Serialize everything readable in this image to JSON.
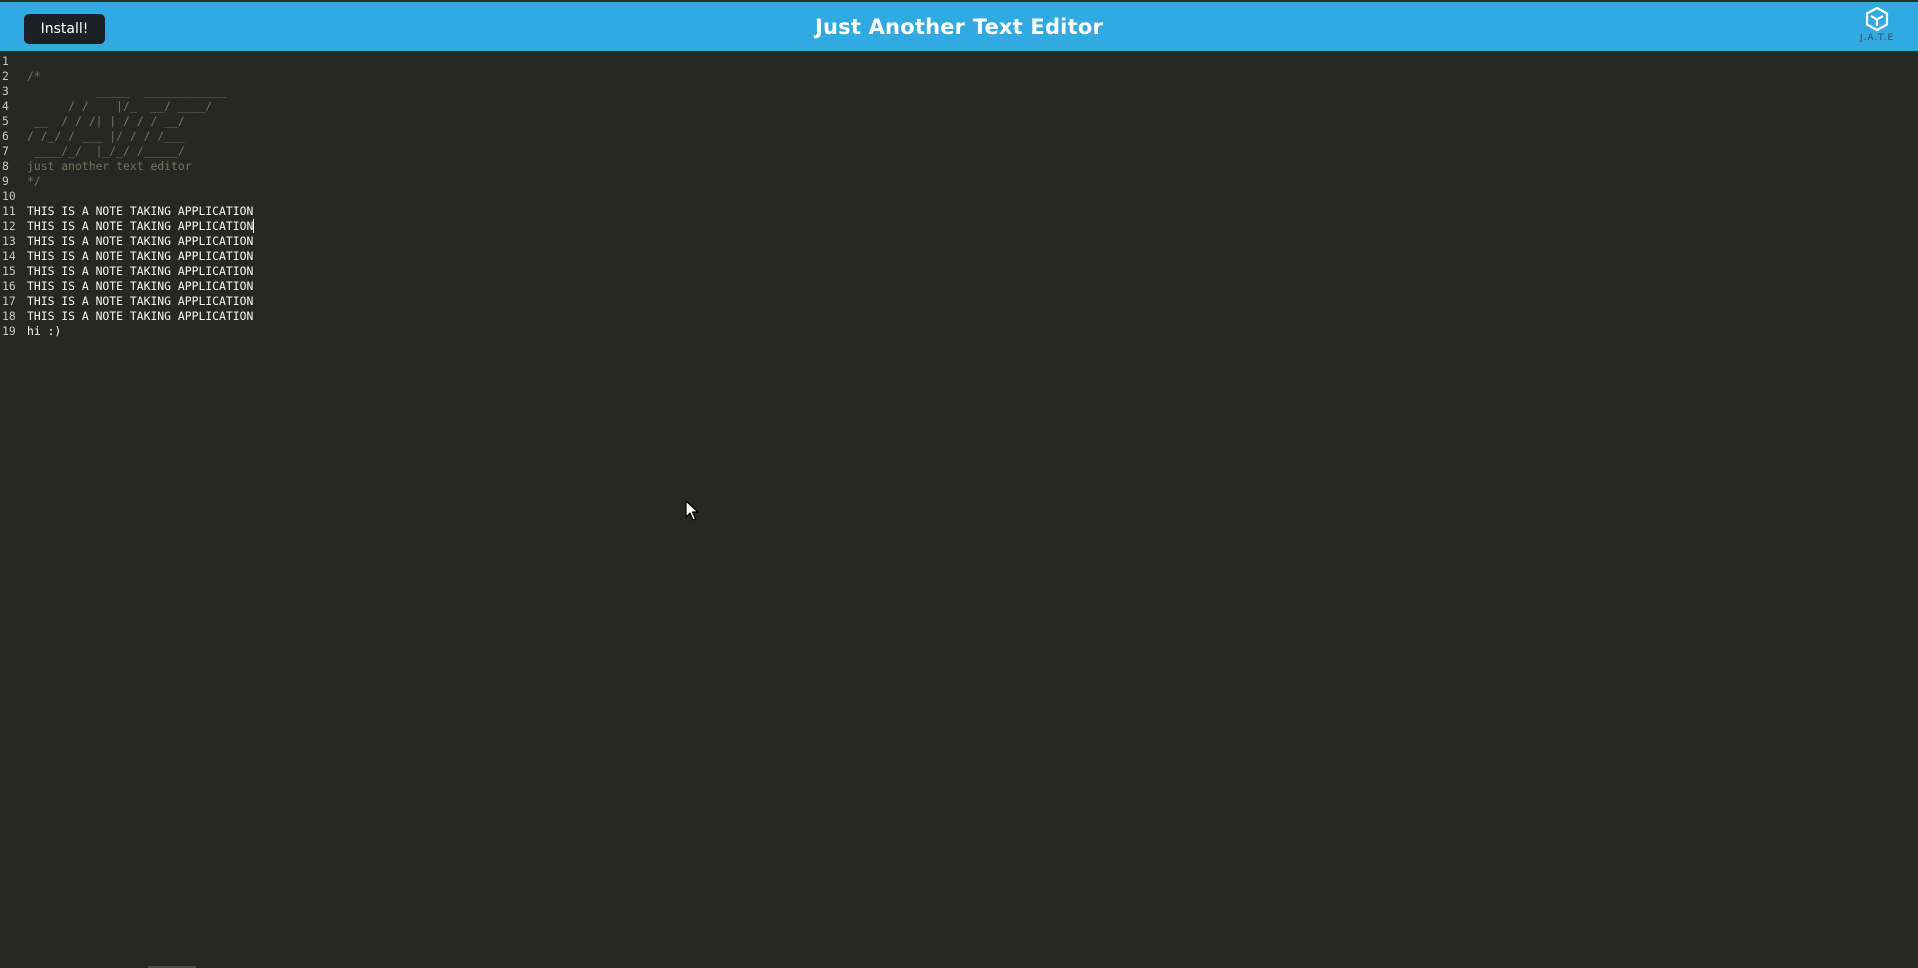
{
  "navbar": {
    "install_label": "Install!",
    "title": "Just Another Text Editor",
    "logo_text": "J.A.T.E",
    "background": "#31a9e1"
  },
  "editor": {
    "background": "#272822",
    "cursor_line": 12,
    "lines": [
      {
        "number": "1",
        "text": "",
        "type": "code"
      },
      {
        "number": "2",
        "text": "/*",
        "type": "comment"
      },
      {
        "number": "3",
        "text": "          _____  ____________",
        "type": "comment"
      },
      {
        "number": "4",
        "text": "      / /    |/_  __/ ____/",
        "type": "comment"
      },
      {
        "number": "5",
        "text": " __  / / /| | / / / __/",
        "type": "comment"
      },
      {
        "number": "6",
        "text": "/ /_/ / ___ |/ / / /___",
        "type": "comment"
      },
      {
        "number": "7",
        "text": " ____/_/  |_/_/ /_____/",
        "type": "comment"
      },
      {
        "number": "8",
        "text": "just another text editor",
        "type": "comment"
      },
      {
        "number": "9",
        "text": "*/",
        "type": "comment"
      },
      {
        "number": "10",
        "text": "",
        "type": "code"
      },
      {
        "number": "11",
        "text": "THIS IS A NOTE TAKING APPLICATION",
        "type": "code"
      },
      {
        "number": "12",
        "text": "THIS IS A NOTE TAKING APPLICATION",
        "type": "code"
      },
      {
        "number": "13",
        "text": "THIS IS A NOTE TAKING APPLICATION",
        "type": "code"
      },
      {
        "number": "14",
        "text": "THIS IS A NOTE TAKING APPLICATION",
        "type": "code"
      },
      {
        "number": "15",
        "text": "THIS IS A NOTE TAKING APPLICATION",
        "type": "code"
      },
      {
        "number": "16",
        "text": "THIS IS A NOTE TAKING APPLICATION",
        "type": "code"
      },
      {
        "number": "17",
        "text": "THIS IS A NOTE TAKING APPLICATION",
        "type": "code"
      },
      {
        "number": "18",
        "text": "THIS IS A NOTE TAKING APPLICATION",
        "type": "code"
      },
      {
        "number": "19",
        "text": "hi :)",
        "type": "code"
      }
    ]
  }
}
